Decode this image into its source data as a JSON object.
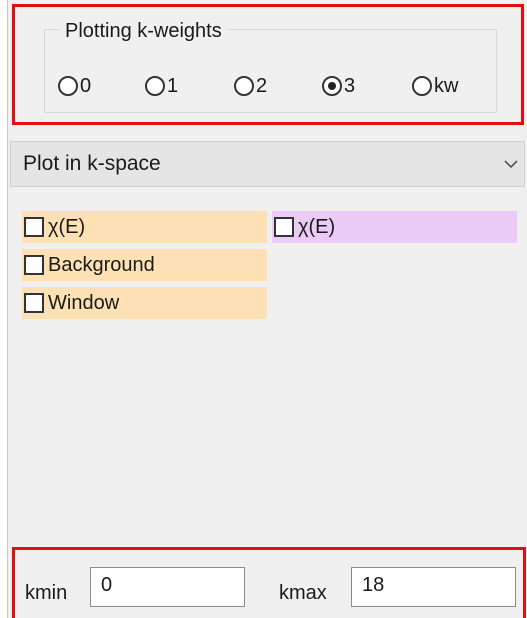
{
  "kweights": {
    "title": "Plotting k-weights",
    "options": [
      {
        "label": "0",
        "selected": false
      },
      {
        "label": "1",
        "selected": false
      },
      {
        "label": "2",
        "selected": false
      },
      {
        "label": "3",
        "selected": true
      },
      {
        "label": "kw",
        "selected": false
      }
    ]
  },
  "plot_space": {
    "value": "Plot in k-space"
  },
  "checkboxes": [
    {
      "label": "χ(E)",
      "checked": false,
      "color": "#fde0b3"
    },
    {
      "label": "χ(E)",
      "checked": false,
      "color": "#ecccf6"
    },
    {
      "label": "Background",
      "checked": false,
      "color": "#fde0b3"
    },
    {
      "label": "Window",
      "checked": false,
      "color": "#fde0b3"
    }
  ],
  "range": {
    "kmin_label": "kmin",
    "kmin_value": "0",
    "kmax_label": "kmax",
    "kmax_value": "18"
  },
  "highlight_color": "#e01010"
}
